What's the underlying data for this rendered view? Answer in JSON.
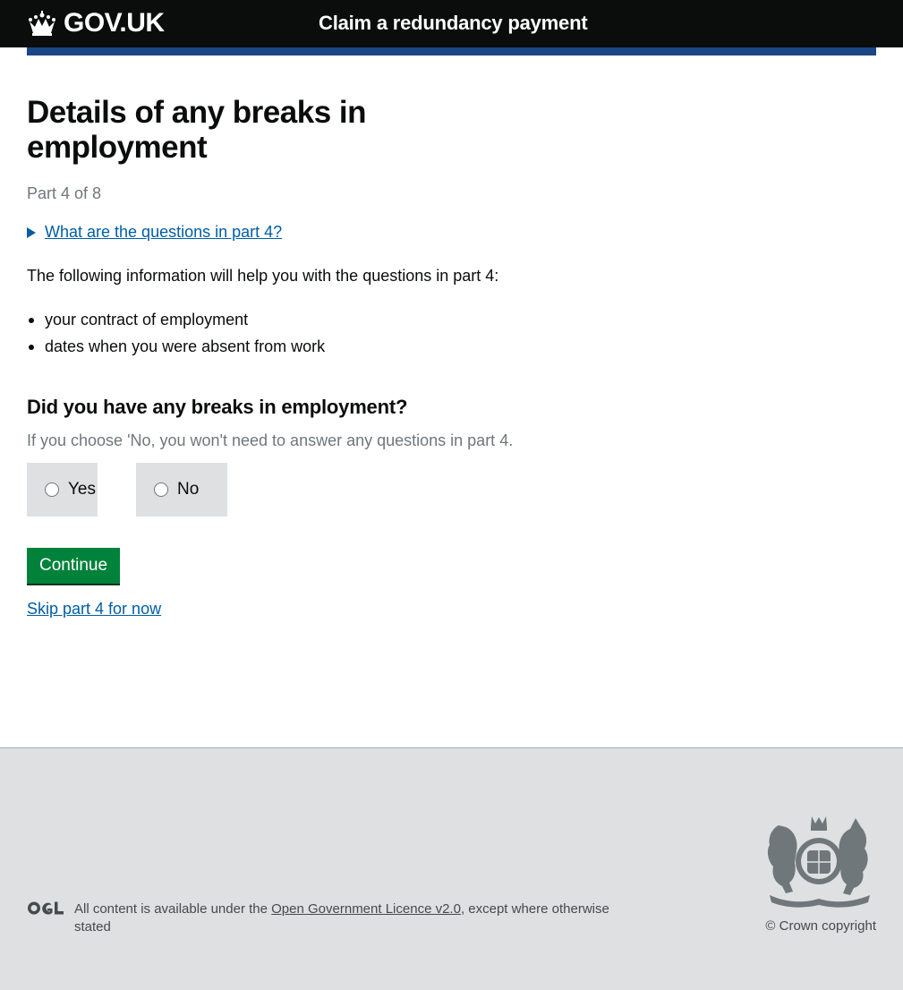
{
  "header": {
    "logo_text": "GOV.UK",
    "service_name": "Claim a redundancy payment"
  },
  "main": {
    "title": "Details of any breaks in employment",
    "caption": "Part 4 of 8",
    "details_summary": "What are the questions in part 4?",
    "intro": "The following information will help you with the questions in part 4:",
    "bullets": [
      "your contract of employment",
      "dates when you were absent from work"
    ],
    "question": "Did you have any breaks in employment?",
    "hint": "If you choose 'No, you won't need to answer any questions in part 4.",
    "options": [
      {
        "label": "Yes",
        "selected": false
      },
      {
        "label": "No",
        "selected": false
      }
    ],
    "continue_label": "Continue",
    "skip_label": "Skip part 4 for now"
  },
  "footer": {
    "licence_prefix": "All content is available under the ",
    "licence_link": "Open Government Licence v2.0",
    "licence_suffix": ", except where otherwise stated",
    "copyright": "© Crown copyright"
  },
  "colors": {
    "header_bg": "#0b0c0c",
    "blue_bar": "#1d4685",
    "link": "#005ea5",
    "button": "#00823b",
    "footer_bg": "#dee0e2",
    "secondary_text": "#6f777b"
  },
  "icons": [
    "crown-icon",
    "disclosure-triangle-icon",
    "ogl-logo",
    "royal-coat-of-arms"
  ]
}
